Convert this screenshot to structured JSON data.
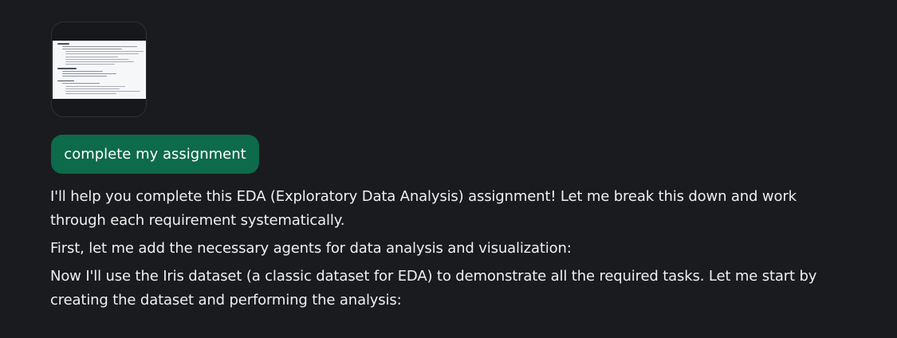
{
  "attachment": {
    "icon": "document-thumbnail-icon",
    "lines": [
      {
        "kind": "head",
        "w": 14
      },
      {
        "kind": "bullet",
        "w": 88
      },
      {
        "kind": "bullet",
        "w": 70
      },
      {
        "kind": "sub",
        "w": 92
      },
      {
        "kind": "sub",
        "w": 86
      },
      {
        "kind": "sub",
        "w": 62
      },
      {
        "kind": "sub",
        "w": 74
      },
      {
        "kind": "sub",
        "w": 80
      },
      {
        "kind": "sub",
        "w": 58
      },
      {
        "kind": "spacer",
        "w": 0
      },
      {
        "kind": "head",
        "w": 22
      },
      {
        "kind": "bullet",
        "w": 48
      },
      {
        "kind": "bullet",
        "w": 64
      },
      {
        "kind": "bullet",
        "w": 52
      },
      {
        "kind": "spacer",
        "w": 0
      },
      {
        "kind": "head",
        "w": 20
      },
      {
        "kind": "bullet",
        "w": 44
      },
      {
        "kind": "sub",
        "w": 70
      },
      {
        "kind": "sub",
        "w": 64
      },
      {
        "kind": "sub",
        "w": 88
      },
      {
        "kind": "sub",
        "w": 60
      }
    ]
  },
  "user_message": {
    "text": "complete my assignment",
    "bubble_color": "#0d6a4a"
  },
  "assistant": {
    "paragraphs": [
      "I'll help you complete this EDA (Exploratory Data Analysis) assignment! Let me break this down and work through each requirement systematically.",
      "First, let me add the necessary agents for data analysis and visualization:",
      "Now I'll use the Iris dataset (a classic dataset for EDA) to demonstrate all the required tasks. Let me start by creating the dataset and performing the analysis:"
    ]
  },
  "colors": {
    "background": "#1a1b1e",
    "text": "#f0f0f0"
  }
}
